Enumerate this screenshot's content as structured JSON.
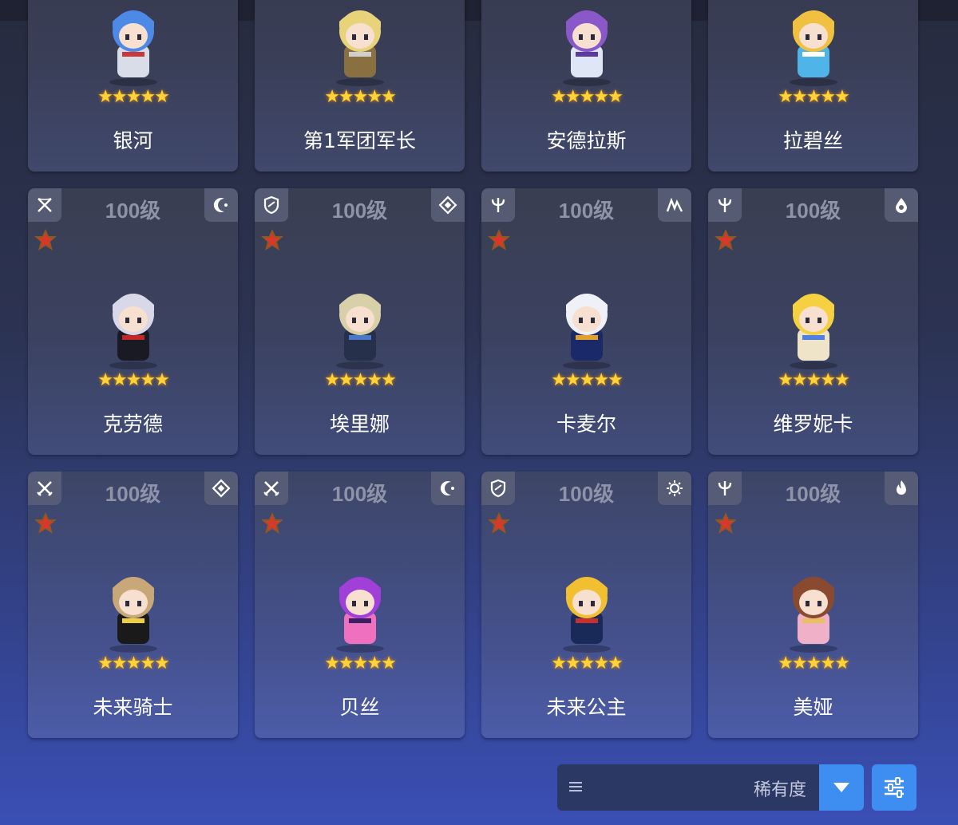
{
  "heroes": [
    {
      "name": "银河",
      "level": "",
      "class_icon": "",
      "element_icon": "",
      "stars": "★★★★★",
      "palette": [
        "#4d8ae8",
        "#d8dde8",
        "#c83838"
      ]
    },
    {
      "name": "第1军团军长",
      "level": "",
      "class_icon": "",
      "element_icon": "",
      "stars": "★★★★★",
      "palette": [
        "#e8d27a",
        "#8a7040",
        "#cfcfcf"
      ]
    },
    {
      "name": "安德拉斯",
      "level": "",
      "class_icon": "",
      "element_icon": "",
      "stars": "★★★★★",
      "palette": [
        "#8a58c8",
        "#dfe6f5",
        "#5a3a9a"
      ]
    },
    {
      "name": "拉碧丝",
      "level": "",
      "class_icon": "",
      "element_icon": "",
      "stars": "★★★★★",
      "palette": [
        "#f0c040",
        "#4fb4e8",
        "#ffffff"
      ]
    },
    {
      "name": "克劳德",
      "level": "100级",
      "class_icon": "bow-crossed-icon",
      "element_icon": "moon-icon",
      "stars": "★★★★★",
      "palette": [
        "#d8d8e8",
        "#1a1a24",
        "#c02828"
      ]
    },
    {
      "name": "埃里娜",
      "level": "100级",
      "class_icon": "shield-icon",
      "element_icon": "earth-icon",
      "stars": "★★★★★",
      "palette": [
        "#d8d0a8",
        "#27304a",
        "#4a78c8"
      ]
    },
    {
      "name": "卡麦尔",
      "level": "100级",
      "class_icon": "trident-icon",
      "element_icon": "wind-icon",
      "stars": "★★★★★",
      "palette": [
        "#f0f0f8",
        "#1a2a68",
        "#e0a030"
      ]
    },
    {
      "name": "维罗妮卡",
      "level": "100级",
      "class_icon": "trident-icon",
      "element_icon": "water-icon",
      "stars": "★★★★★",
      "palette": [
        "#f5d040",
        "#f0e4c8",
        "#5080e0"
      ]
    },
    {
      "name": "未来骑士",
      "level": "100级",
      "class_icon": "swords-icon",
      "element_icon": "earth-icon",
      "stars": "★★★★★",
      "palette": [
        "#c8a878",
        "#1a1a1a",
        "#f0d040"
      ]
    },
    {
      "name": "贝丝",
      "level": "100级",
      "class_icon": "swords-icon",
      "element_icon": "moon-icon",
      "stars": "★★★★★",
      "palette": [
        "#a040d8",
        "#f070c0",
        "#3a2060"
      ]
    },
    {
      "name": "未来公主",
      "level": "100级",
      "class_icon": "shield-icon",
      "element_icon": "sun-icon",
      "stars": "★★★★★",
      "palette": [
        "#f0c030",
        "#1a2a58",
        "#c83030"
      ]
    },
    {
      "name": "美娅",
      "level": "100级",
      "class_icon": "trident-icon",
      "element_icon": "fire-icon",
      "stars": "★★★★★",
      "palette": [
        "#8a4a30",
        "#f0b0c8",
        "#e8c060"
      ]
    }
  ],
  "sort": {
    "menu_icon": "list-icon",
    "label": "稀有度",
    "dropdown_icon": "chevron-down-icon"
  },
  "filter": {
    "icon": "sliders-icon"
  },
  "colors": {
    "accent": "#3e8df0",
    "star": "#ffd33a",
    "rank_badge": "#d8382a"
  }
}
